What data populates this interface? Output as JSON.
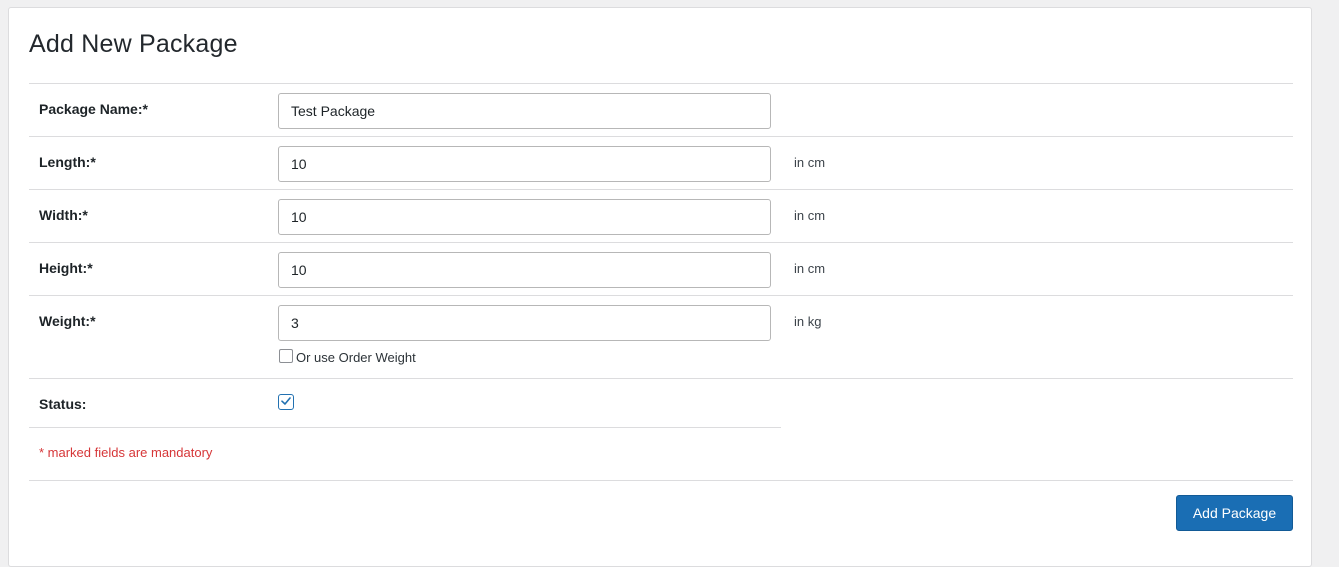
{
  "page": {
    "title": "Add New Package"
  },
  "form": {
    "package_name": {
      "label": "Package Name:*",
      "value": "Test Package"
    },
    "length": {
      "label": "Length:*",
      "value": "10",
      "unit": "in cm"
    },
    "width": {
      "label": "Width:*",
      "value": "10",
      "unit": "in cm"
    },
    "height": {
      "label": "Height:*",
      "value": "10",
      "unit": "in cm"
    },
    "weight": {
      "label": "Weight:*",
      "value": "3",
      "unit": "in kg",
      "order_weight_label": "Or use Order Weight",
      "order_weight_checked": false
    },
    "status": {
      "label": "Status:",
      "checked": true
    },
    "mandatory_note": "* marked fields are mandatory",
    "submit_label": "Add Package"
  },
  "colors": {
    "primary_button": "#1a6eb4",
    "mandatory_text": "#d63638",
    "checkbox_checked": "#2271b1"
  }
}
